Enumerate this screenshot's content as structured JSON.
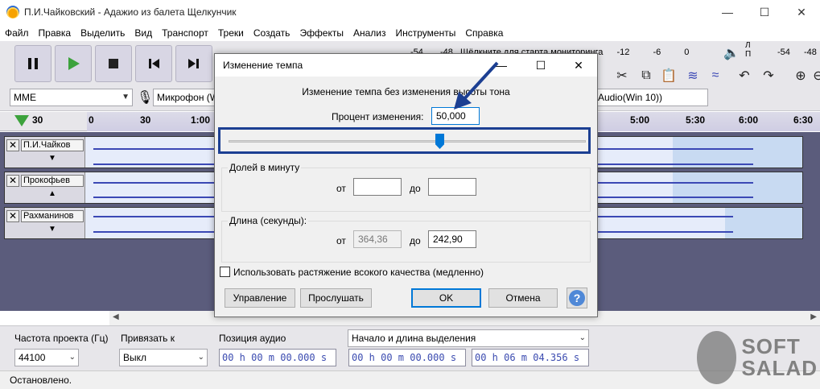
{
  "window": {
    "title": "П.И.Чайковский - Адажио из балета Щелкунчик",
    "minimize": "—",
    "maximize": "☐",
    "close": "✕"
  },
  "menu": [
    "Файл",
    "Правка",
    "Выделить",
    "Вид",
    "Транспорт",
    "Треки",
    "Создать",
    "Эффекты",
    "Анализ",
    "Инструменты",
    "Справка"
  ],
  "toolbar": {
    "host": "MME",
    "mic_device": "Микрофон (W",
    "out_device": "Audio(Win 10))",
    "meter_rec": [
      "-54",
      "-48",
      "Щёлкните для старта мониторинга",
      "-12",
      "-6",
      "0"
    ],
    "meter_play": [
      "-54",
      "-48"
    ],
    "meter_rec_letters": "Л П",
    "meter_play_letters": "Л П",
    "icons": [
      "pause-icon",
      "play-icon",
      "stop-icon",
      "skip-start-icon",
      "skip-end-icon"
    ]
  },
  "timeline": {
    "ticks": [
      "30",
      "0",
      "30",
      "1:00",
      "5:00",
      "5:30",
      "6:00",
      "6:30"
    ]
  },
  "tracks": [
    {
      "name": "П.И.Чайков",
      "collapse": "▼"
    },
    {
      "name": "Прокофьев",
      "collapse": "▲"
    },
    {
      "name": "Рахманинов",
      "collapse": "▼"
    }
  ],
  "selection_bar": {
    "rate_label": "Частота проекта (Гц)",
    "rate_value": "44100",
    "snap_label": "Привязать к",
    "snap_value": "Выкл",
    "pos_label": "Позиция аудио",
    "pos_value": "00 h 00 m 00.000 s",
    "sel_label": "Начало и длина выделения",
    "sel_start": "00 h 00 m 00.000 s",
    "sel_len": "00 h 06 m 04.356 s"
  },
  "status": "Остановлено.",
  "watermark": {
    "line1": "SOFT",
    "line2": "SALAD"
  },
  "dialog": {
    "title": "Изменение темпа",
    "heading": "Изменение темпа без изменения высоты тона",
    "percent_label": "Процент изменения:",
    "percent_value": "50,000",
    "slider_percent": 50,
    "bpm_group": "Долей в минуту",
    "from_label": "от",
    "to_label": "до",
    "bpm_from": "",
    "bpm_to": "",
    "length_group": "Длина (секунды):",
    "len_from": "364,36",
    "len_to": "242,90",
    "hq_label": "Использовать растяжение всокого качества (медленно)",
    "btn_manage": "Управление",
    "btn_preview": "Прослушать",
    "btn_ok": "OK",
    "btn_cancel": "Отмена",
    "help": "?"
  },
  "colors": {
    "accent": "#0078d7",
    "annotation": "#1c3f92",
    "track_bg": "#5b5c7c",
    "wave": "#3b48b5"
  }
}
